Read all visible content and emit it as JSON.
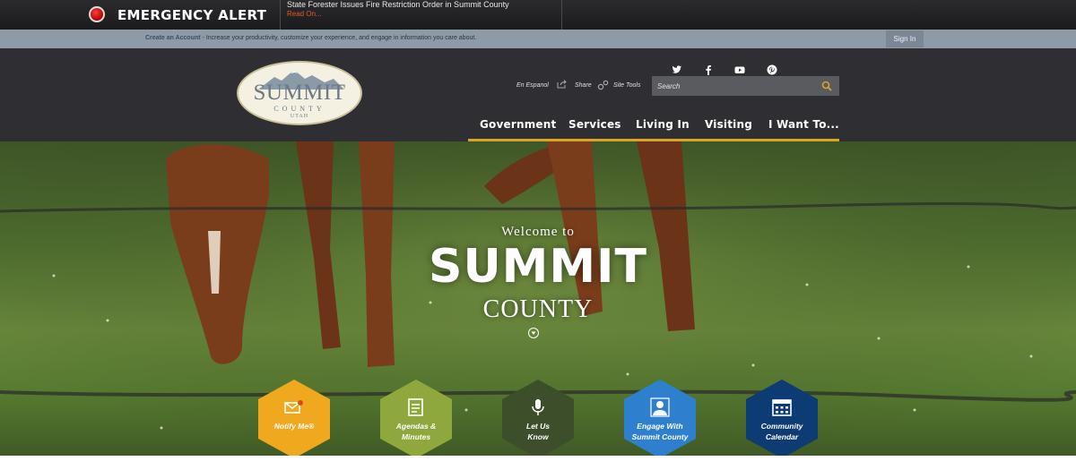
{
  "alert": {
    "title": "EMERGENCY ALERT",
    "headline": "State Forester Issues Fire Restriction Order in Summit County",
    "read_on": "Read On..."
  },
  "account_bar": {
    "create_account": "Create an Account",
    "message": " - Increase your productivity, customize your experience, and engage in information you care about.",
    "sign_in": "Sign In"
  },
  "logo": {
    "line1": "SUMMIT",
    "line2": "COUNTY",
    "line3": "UTAH"
  },
  "social": [
    "twitter-icon",
    "facebook-icon",
    "youtube-icon",
    "pinterest-icon"
  ],
  "tools": {
    "espanol": "En Espanol",
    "share": "Share",
    "site_tools": "Site Tools"
  },
  "search": {
    "placeholder": "Search"
  },
  "nav": [
    "Government",
    "Services",
    "Living In",
    "Visiting",
    "I Want To..."
  ],
  "hero": {
    "welcome": "Welcome to",
    "title": "SUMMIT",
    "subtitle": "COUNTY"
  },
  "quick_links": [
    {
      "label1": "Notify Me®",
      "label2": "",
      "color": "#f0a81e",
      "icon": "envelope-icon"
    },
    {
      "label1": "Agendas &",
      "label2": "Minutes",
      "color": "#8ea83d",
      "icon": "notepad-icon"
    },
    {
      "label1": "Let Us",
      "label2": "Know",
      "color": "#3d4f2a",
      "icon": "microphone-icon"
    },
    {
      "label1": "Engage With",
      "label2": "Summit County",
      "color": "#2f7fcf",
      "icon": "person-icon"
    },
    {
      "label1": "Community",
      "label2": "Calendar",
      "color": "#0d3b73",
      "icon": "calendar-icon"
    }
  ],
  "colors": {
    "accent": "#d8a526",
    "header_bg": "#2f2f33",
    "account_bar": "#8e9aa6",
    "alert_red": "#cc0000"
  }
}
